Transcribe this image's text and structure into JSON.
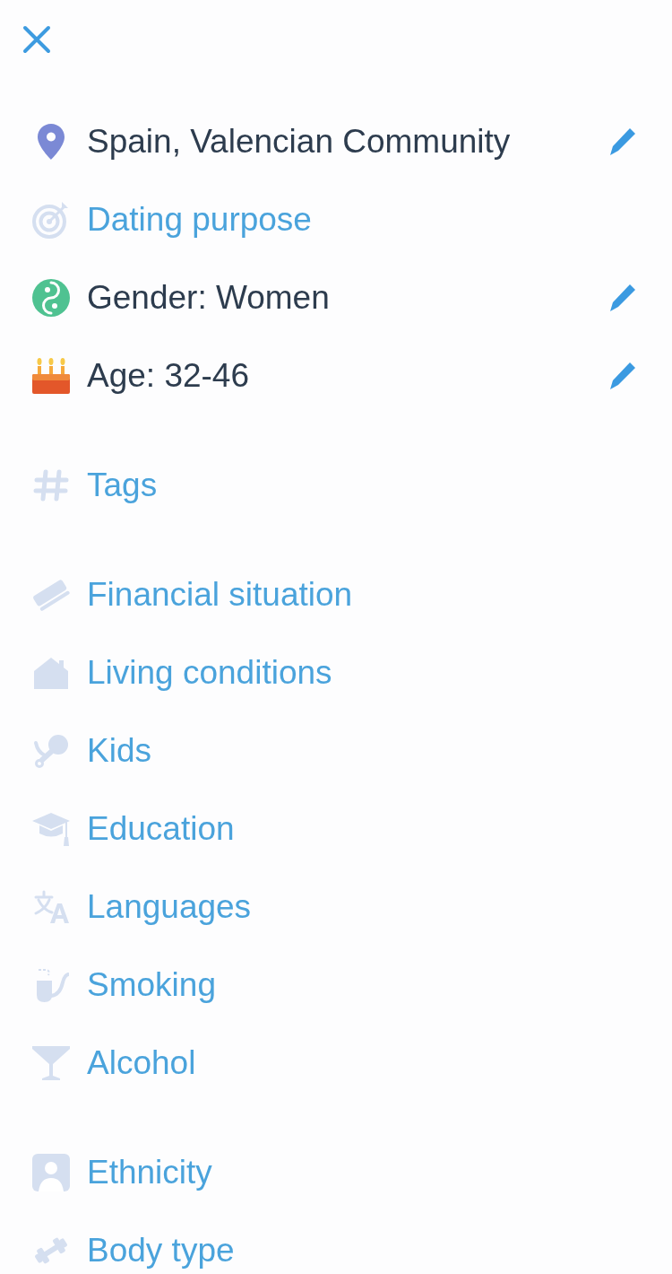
{
  "sections": [
    {
      "items": [
        {
          "kind": "value",
          "label": "Spain, Valencian Community",
          "editable": true
        },
        {
          "kind": "prompt",
          "label": "Dating purpose",
          "editable": false
        },
        {
          "kind": "value",
          "label": "Gender: Women",
          "editable": true
        },
        {
          "kind": "value",
          "label": "Age: 32-46",
          "editable": true
        }
      ]
    },
    {
      "items": [
        {
          "kind": "prompt",
          "label": "Tags",
          "editable": false
        }
      ]
    },
    {
      "items": [
        {
          "kind": "prompt",
          "label": "Financial situation",
          "editable": false
        },
        {
          "kind": "prompt",
          "label": "Living conditions",
          "editable": false
        },
        {
          "kind": "prompt",
          "label": "Kids",
          "editable": false
        },
        {
          "kind": "prompt",
          "label": "Education",
          "editable": false
        },
        {
          "kind": "prompt",
          "label": "Languages",
          "editable": false
        },
        {
          "kind": "prompt",
          "label": "Smoking",
          "editable": false
        },
        {
          "kind": "prompt",
          "label": "Alcohol",
          "editable": false
        }
      ]
    },
    {
      "items": [
        {
          "kind": "prompt",
          "label": "Ethnicity",
          "editable": false
        },
        {
          "kind": "prompt",
          "label": "Body type",
          "editable": false
        }
      ]
    }
  ]
}
